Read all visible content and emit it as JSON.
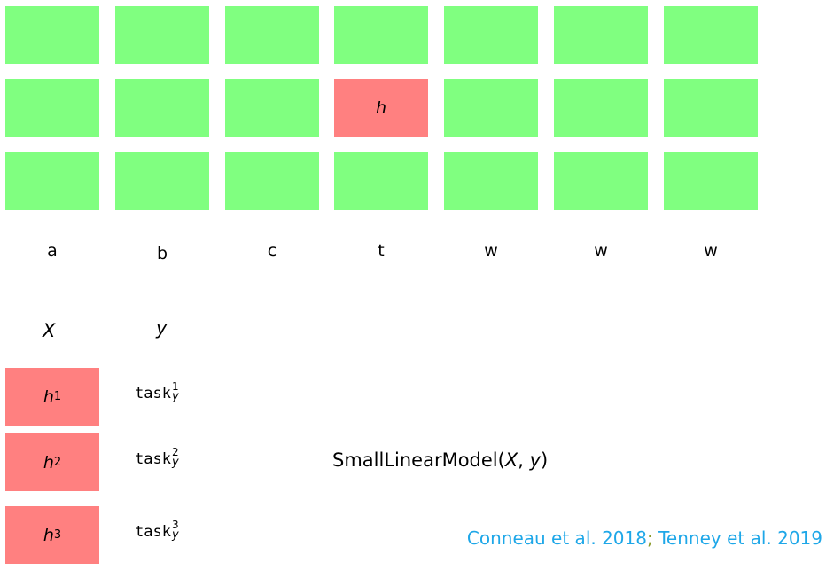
{
  "colors": {
    "cell": "#80ff80",
    "highlight": "#ff8080",
    "citation": "#1ea7e8",
    "separator": "#8a9a2a"
  },
  "grid": {
    "rows": 3,
    "cols": 7,
    "highlight": {
      "row": 1,
      "col": 3,
      "label": "h"
    }
  },
  "tokens": [
    "a",
    "b",
    "c",
    "t",
    "w",
    "w",
    "w"
  ],
  "headers": {
    "x": "X",
    "y": "y"
  },
  "probes": [
    {
      "h": "h",
      "sub": "1",
      "task": "task",
      "sup": "1",
      "y": "y"
    },
    {
      "h": "h",
      "sub": "2",
      "task": "task",
      "sup": "2",
      "y": "y"
    },
    {
      "h": "h",
      "sub": "3",
      "task": "task",
      "sup": "3",
      "y": "y"
    }
  ],
  "model": {
    "name": "SmallLinearModel",
    "open": "(",
    "x": "X",
    "comma": ", ",
    "y": "y",
    "close": ")"
  },
  "citation": {
    "first": "Conneau et al. 2018",
    "sep": ";",
    "second": " Tenney et al. 2019"
  }
}
